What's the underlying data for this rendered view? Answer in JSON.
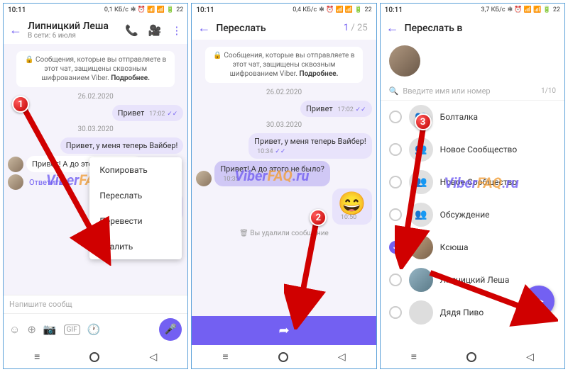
{
  "status": {
    "time": "10:11",
    "net1": "0,1 КБ/с",
    "net2": "0,4 КБ/с",
    "net3": "3,7 КБ/с",
    "battery": "22"
  },
  "p1": {
    "name": "Липницкий Леша",
    "sub": "В сети: 6 июля",
    "enc": "🔒 Сообщения, которые вы отправляете в этот чат, защищены сквозным шифрованием Viber.",
    "enc_more": "Подробнее.",
    "date1": "26.02.2020",
    "m1": "Привет",
    "t1": "17:02",
    "date2": "30.03.2020",
    "m2": "Привет, у меня теперь Вайбер!",
    "m3": "Привет! А до этого не было?",
    "reply": "Ответить",
    "menu": {
      "copy": "Копировать",
      "fwd": "Переслать",
      "trans": "Перевести",
      "del": "Удалить"
    },
    "input_ph": "Напишите сообщ"
  },
  "p2": {
    "title": "Переслать",
    "cur": "1",
    "total": "25",
    "enc": "🔒 Сообщения, которые вы отправляете в этот чат, защищены сквозным шифрованием Viber.",
    "enc_more": "Подробнее.",
    "date1": "26.02.2020",
    "m1": "Привет",
    "t1": "17:02",
    "date2": "30.03.2020",
    "m2": "Привет, у меня теперь Вайбер!",
    "t2": "10:34",
    "m3": "Привет! А до этого не было?",
    "t3": "10:35",
    "t4": "10:50",
    "deleted": "Вы удалили сообщение"
  },
  "p3": {
    "title": "Переслать в",
    "search_ph": "Введите имя или номер",
    "counter": "1/10",
    "contacts": [
      "Болталка",
      "Новое Сообщество",
      "Новое Сообщество",
      "Обсуждение",
      "Ксюша",
      "Липницкий Леша",
      "Дядя Пиво"
    ]
  },
  "wm": {
    "v": "Viber",
    "f": "FAQ",
    "r": ".ru"
  },
  "badges": {
    "b1": "1",
    "b2": "2",
    "b3": "3"
  }
}
